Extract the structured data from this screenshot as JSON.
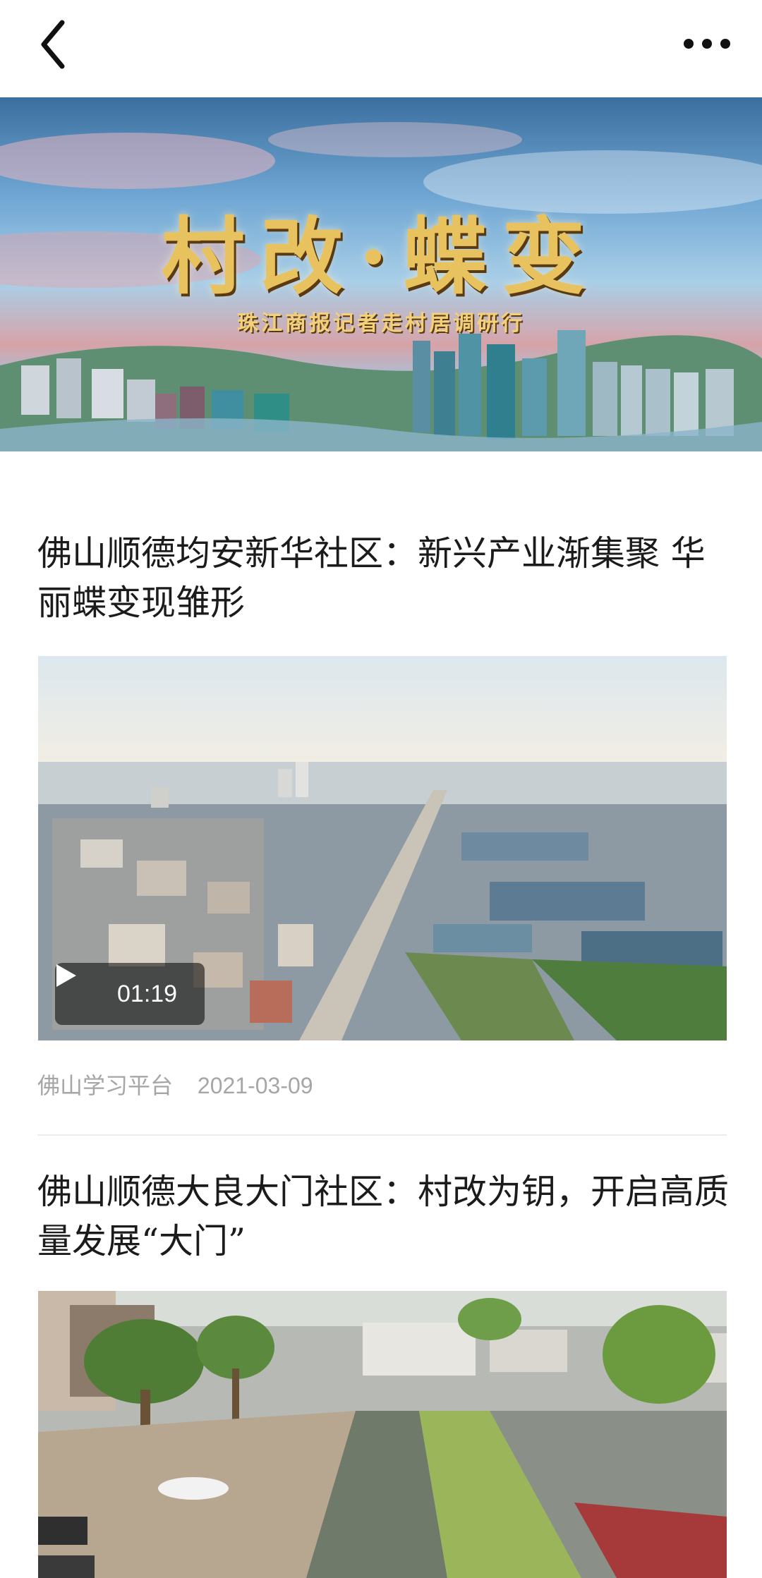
{
  "nav": {
    "back_icon": "chevron-left-icon",
    "more_icon": "more-horizontal-icon"
  },
  "banner": {
    "title": "村改·蝶变",
    "subtitle": "珠江商报记者走村居调研行"
  },
  "articles": [
    {
      "title": "佛山顺德均安新华社区：新兴产业渐集聚 华丽蝶变现雏形",
      "duration": "01:19",
      "source": "佛山学习平台",
      "date": "2021-03-09"
    },
    {
      "title": "佛山顺德大良大门社区：村改为钥，开启高质量发展“大门”"
    }
  ],
  "colors": {
    "title_text": "#1b1b1b",
    "meta_text": "#a6a6a6",
    "divider": "#ececec",
    "banner_gold": "#e8c25f"
  }
}
